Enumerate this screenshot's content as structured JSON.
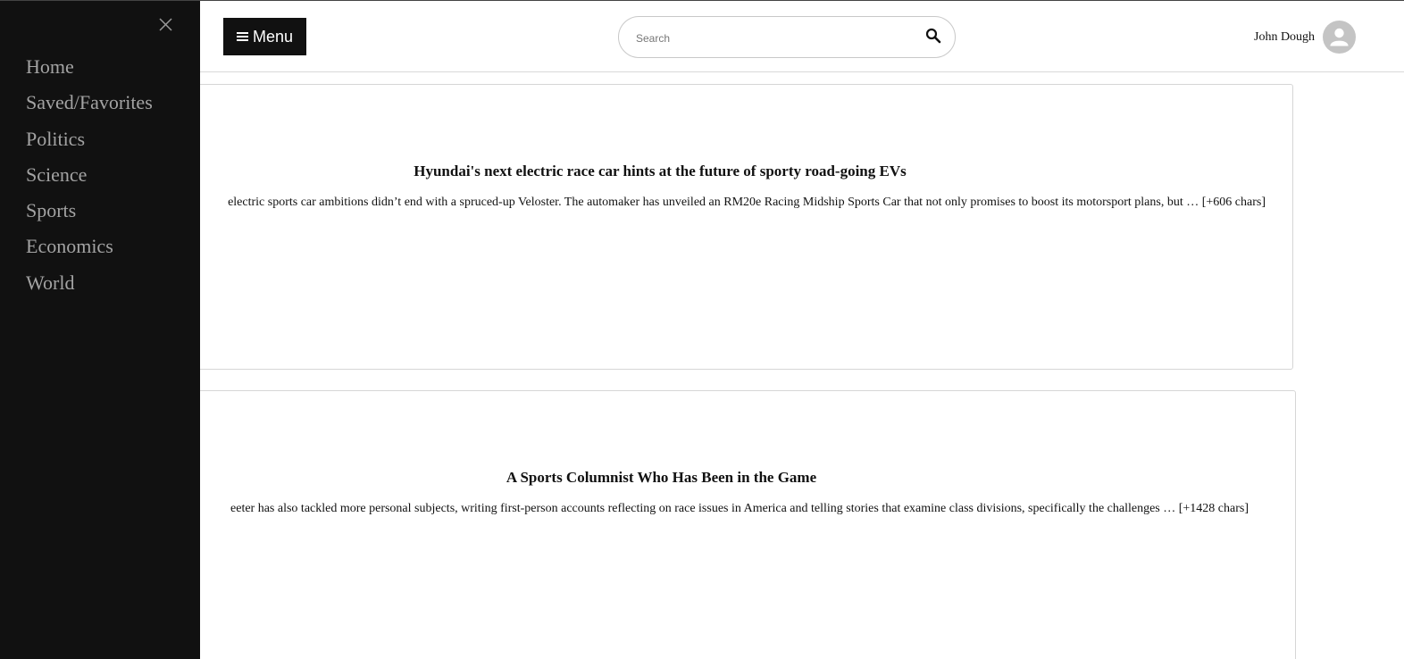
{
  "sidebar": {
    "items": [
      {
        "label": "Home"
      },
      {
        "label": "Saved/Favorites"
      },
      {
        "label": "Politics"
      },
      {
        "label": "Science"
      },
      {
        "label": "Sports"
      },
      {
        "label": "Economics"
      },
      {
        "label": "World"
      }
    ],
    "close_icon": "close-icon"
  },
  "header": {
    "menu_label": "Menu",
    "menu_icon": "hamburger-icon",
    "search": {
      "placeholder": "Search",
      "value": "",
      "icon": "search-icon"
    },
    "user": {
      "name": "John Dough",
      "avatar_icon": "user-avatar-icon"
    }
  },
  "articles": [
    {
      "title": "Hyundai's next electric race car hints at the future of sporty road-going EVs",
      "description": "electric sports car ambitions didn’t end with a spruced-up Veloster. The automaker has unveiled an RM20e Racing Midship Sports Car that not only promises to boost its motorsport plans, but … [+606 chars]"
    },
    {
      "title": "A Sports Columnist Who Has Been in the Game",
      "description": "eeter has also tackled more personal subjects, writing first-person accounts reflecting on race issues in America and telling stories that examine class divisions, specifically the challenges … [+1428 chars]"
    }
  ],
  "colors": {
    "sidebar_bg": "#111111",
    "sidebar_text": "#a3a3a3",
    "menu_button_bg": "#111111",
    "avatar_bg": "#c4c4c4"
  }
}
